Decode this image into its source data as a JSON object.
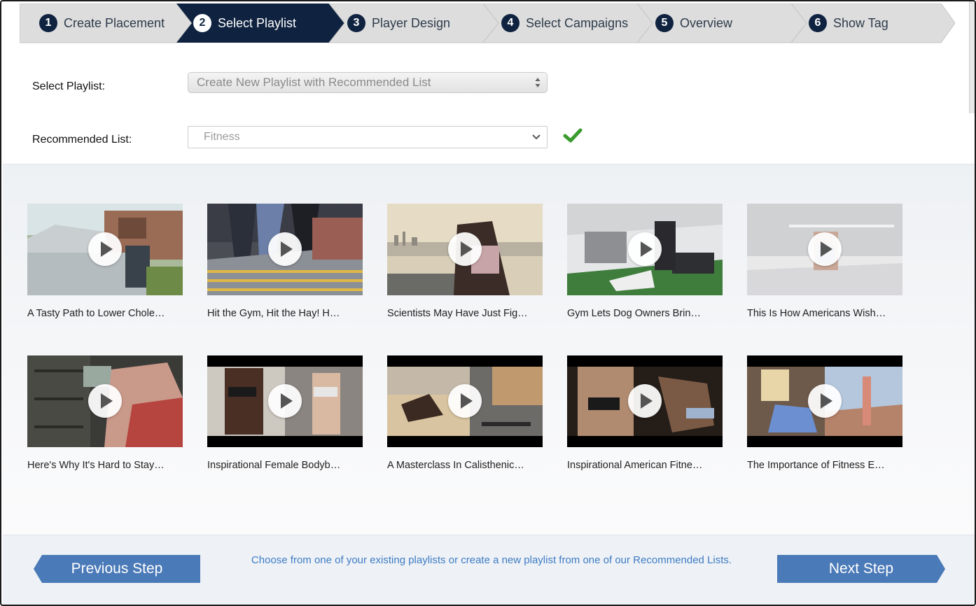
{
  "steps": [
    {
      "num": "1",
      "label": "Create Placement",
      "active": false
    },
    {
      "num": "2",
      "label": "Select Playlist",
      "active": true
    },
    {
      "num": "3",
      "label": "Player Design",
      "active": false
    },
    {
      "num": "4",
      "label": "Select Campaigns",
      "active": false
    },
    {
      "num": "5",
      "label": "Overview",
      "active": false
    },
    {
      "num": "6",
      "label": "Show Tag",
      "active": false
    }
  ],
  "form": {
    "playlist_label": "Select Playlist:",
    "playlist_value": "Create New Playlist with Recommended List",
    "recommended_label": "Recommended List:",
    "recommended_value": "Fitness"
  },
  "videos": [
    {
      "title": "A Tasty Path to Lower Chole…"
    },
    {
      "title": "Hit the Gym, Hit the Hay! H…"
    },
    {
      "title": "Scientists May Have Just Fig…"
    },
    {
      "title": "Gym Lets Dog Owners Brin…"
    },
    {
      "title": "This Is How Americans Wish…"
    },
    {
      "title": "Here's Why It's Hard to Stay…"
    },
    {
      "title": "Inspirational Female Bodyb…"
    },
    {
      "title": "A Masterclass In Calisthenic…"
    },
    {
      "title": "Inspirational American Fitne…"
    },
    {
      "title": "The Importance of Fitness E…"
    }
  ],
  "footer": {
    "prev_label": "Previous Step",
    "next_label": "Next Step",
    "hint": "Choose from one of your existing playlists or create a new playlist from one of our Recommended Lists."
  },
  "colors": {
    "active_step": "#0f2340",
    "inactive_step": "#dcdcdc",
    "button": "#4b7ab8",
    "hint_text": "#3e7bc4",
    "check": "#3a9b2e"
  }
}
